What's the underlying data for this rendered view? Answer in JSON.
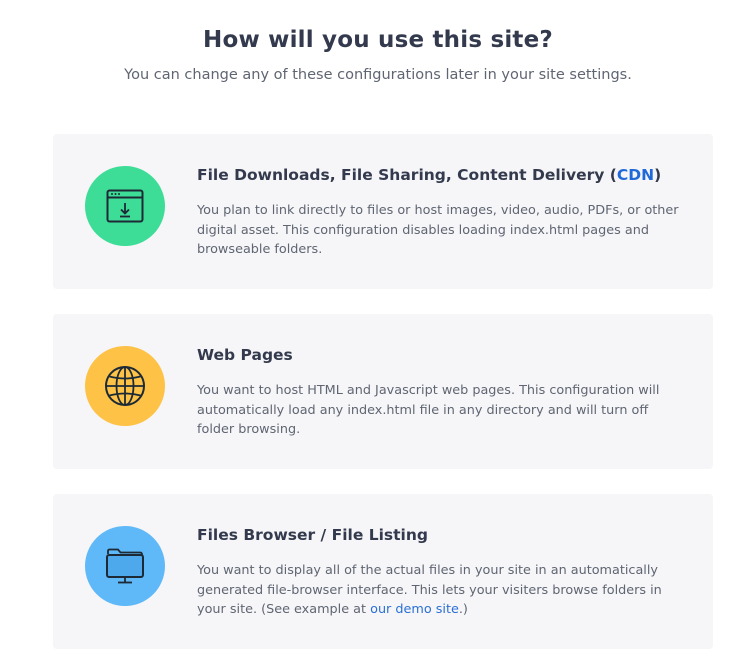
{
  "page": {
    "title": "How will you use this site?",
    "subtitle": "You can change any of these configurations later in your site settings."
  },
  "options": [
    {
      "title_prefix": "File Downloads, File Sharing, Content Delivery (",
      "title_link": "CDN",
      "title_suffix": ")",
      "description": "You plan to link directly to files or host images, video, audio, PDFs, or other digital asset. This configuration disables loading index.html pages and browseable folders.",
      "icon": "download-window-icon",
      "color": "#3ddc97"
    },
    {
      "title": "Web Pages",
      "description": "You want to host HTML and Javascript web pages. This configuration will automatically load any index.html file in any directory and will turn off folder browsing.",
      "icon": "globe-icon",
      "color": "#fdc246"
    },
    {
      "title": "Files Browser / File Listing",
      "description_prefix": "You want to display all of the actual files in your site in an automatically generated file-browser interface. This lets your visiters browse folders in your site. (See example at ",
      "description_link": "our demo site",
      "description_suffix": ".)",
      "icon": "folder-monitor-icon",
      "color": "#5fb8f7"
    }
  ],
  "colors": {
    "link": "#2a6fd6",
    "card_background": "#f6f6f8",
    "text_dark": "#333a4d",
    "text_muted": "#5f6572"
  }
}
